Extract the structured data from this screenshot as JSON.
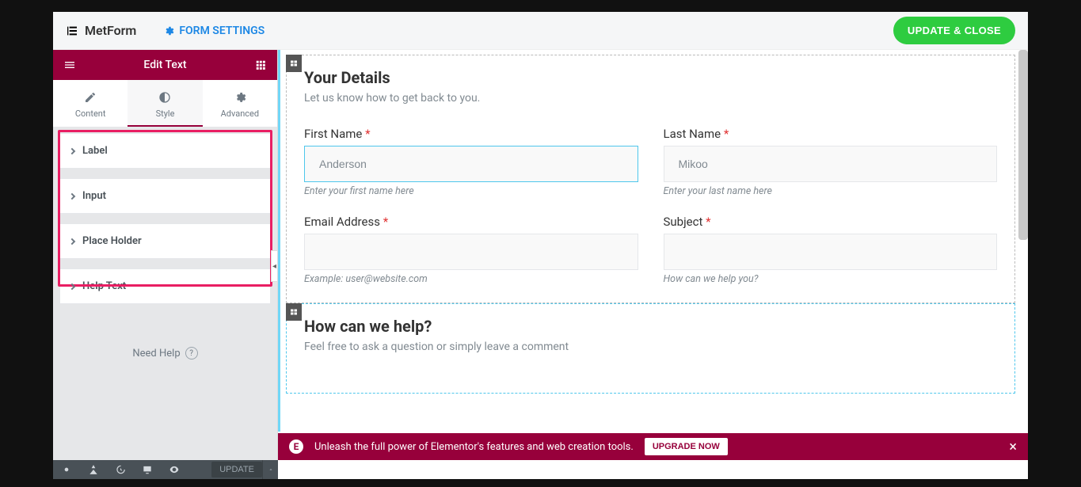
{
  "topbar": {
    "brand": "MetForm",
    "form_settings": "FORM SETTINGS",
    "update_close": "UPDATE & CLOSE"
  },
  "sidebar": {
    "title": "Edit Text",
    "tabs": {
      "content": "Content",
      "style": "Style",
      "advanced": "Advanced"
    },
    "accordion": [
      "Label",
      "Input",
      "Place Holder",
      "Help Text"
    ],
    "need_help": "Need Help"
  },
  "form": {
    "section1": {
      "title": "Your Details",
      "subtitle": "Let us know how to get back to you.",
      "first_name": {
        "label": "First Name",
        "value": "Anderson",
        "hint": "Enter your first name here"
      },
      "last_name": {
        "label": "Last Name",
        "value": "Mikoo",
        "hint": "Enter your last name here"
      },
      "email": {
        "label": "Email Address",
        "hint": "Example: user@website.com"
      },
      "subject": {
        "label": "Subject",
        "hint": "How can we help you?"
      }
    },
    "section2": {
      "title": "How can we help?",
      "subtitle": "Feel free to ask a question or simply leave a comment"
    }
  },
  "promo": {
    "text": "Unleash the full power of Elementor's features and web creation tools.",
    "cta": "UPGRADE NOW"
  },
  "footer": {
    "update": "UPDATE"
  }
}
